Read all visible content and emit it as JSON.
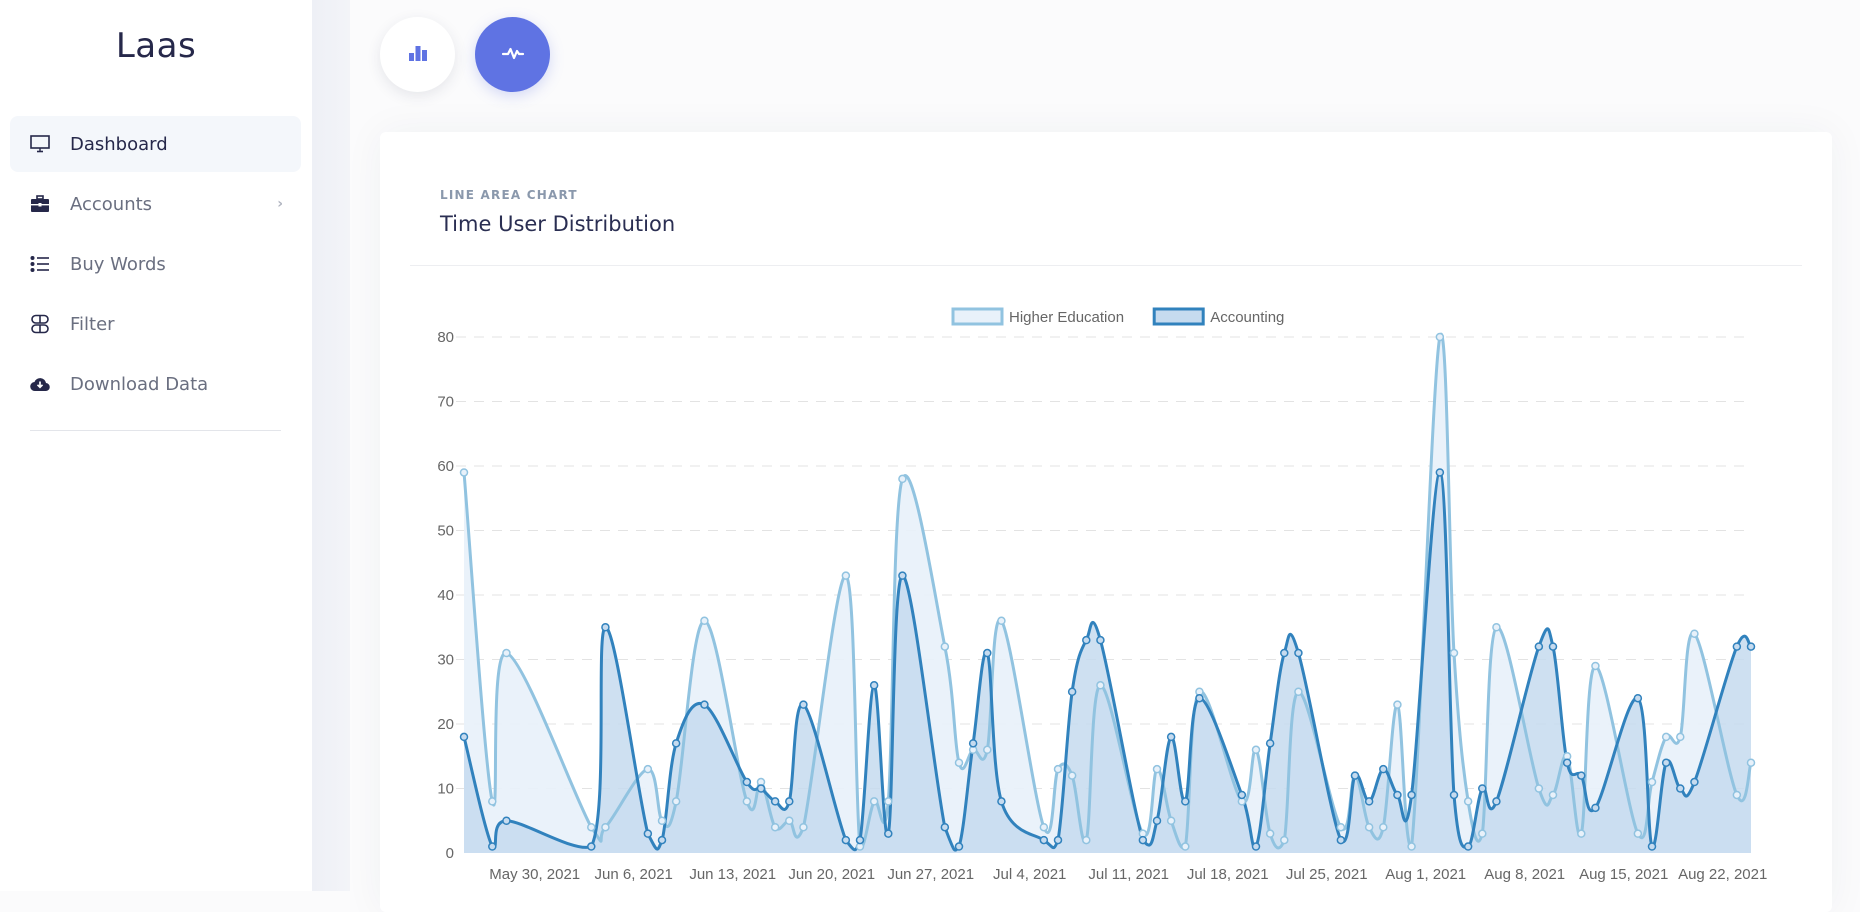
{
  "sidebar": {
    "logo": "Laas",
    "items": [
      {
        "label": "Dashboard",
        "icon": "monitor-icon",
        "active": true
      },
      {
        "label": "Accounts",
        "icon": "briefcase-icon",
        "has_submenu": true
      },
      {
        "label": "Buy Words",
        "icon": "list-icon"
      },
      {
        "label": "Filter",
        "icon": "filter-toggle-icon"
      },
      {
        "label": "Download Data",
        "icon": "cloud-download-icon"
      }
    ]
  },
  "toolbar": {
    "buttons": [
      {
        "name": "bar-chart",
        "icon": "bar-chart-icon",
        "active": false
      },
      {
        "name": "line-chart",
        "icon": "pulse-icon",
        "active": true
      }
    ],
    "accent": "#5f73e3"
  },
  "card": {
    "subtitle": "LINE AREA CHART",
    "title": "Time User Distribution"
  },
  "chart_data": {
    "type": "area",
    "title": "Time User Distribution",
    "xlabel": "",
    "ylabel": "",
    "ylim": [
      0,
      80
    ],
    "yticks": [
      0,
      10,
      20,
      30,
      40,
      50,
      60,
      70,
      80
    ],
    "xrange": [
      "2021-05-25",
      "2021-08-24"
    ],
    "xticks": [
      "May 30, 2021",
      "Jun 6, 2021",
      "Jun 13, 2021",
      "Jun 20, 2021",
      "Jun 27, 2021",
      "Jul 4, 2021",
      "Jul 11, 2021",
      "Jul 18, 2021",
      "Jul 25, 2021",
      "Aug 1, 2021",
      "Aug 8, 2021",
      "Aug 15, 2021",
      "Aug 22, 2021"
    ],
    "xtick_dates": [
      "2021-05-30",
      "2021-06-06",
      "2021-06-13",
      "2021-06-20",
      "2021-06-27",
      "2021-07-04",
      "2021-07-11",
      "2021-07-18",
      "2021-07-25",
      "2021-08-01",
      "2021-08-08",
      "2021-08-15",
      "2021-08-22"
    ],
    "grid": true,
    "legend": "top-center",
    "x": [
      "2021-05-25",
      "2021-05-27",
      "2021-05-28",
      "2021-06-03",
      "2021-06-04",
      "2021-06-07",
      "2021-06-08",
      "2021-06-09",
      "2021-06-11",
      "2021-06-14",
      "2021-06-15",
      "2021-06-16",
      "2021-06-17",
      "2021-06-18",
      "2021-06-21",
      "2021-06-22",
      "2021-06-23",
      "2021-06-24",
      "2021-06-25",
      "2021-06-28",
      "2021-06-29",
      "2021-06-30",
      "2021-07-01",
      "2021-07-02",
      "2021-07-05",
      "2021-07-06",
      "2021-07-07",
      "2021-07-08",
      "2021-07-09",
      "2021-07-12",
      "2021-07-13",
      "2021-07-14",
      "2021-07-15",
      "2021-07-16",
      "2021-07-19",
      "2021-07-20",
      "2021-07-21",
      "2021-07-22",
      "2021-07-23",
      "2021-07-26",
      "2021-07-27",
      "2021-07-28",
      "2021-07-29",
      "2021-07-30",
      "2021-07-31",
      "2021-08-02",
      "2021-08-03",
      "2021-08-04",
      "2021-08-05",
      "2021-08-06",
      "2021-08-09",
      "2021-08-10",
      "2021-08-11",
      "2021-08-12",
      "2021-08-13",
      "2021-08-16",
      "2021-08-17",
      "2021-08-18",
      "2021-08-19",
      "2021-08-20",
      "2021-08-23",
      "2021-08-24"
    ],
    "series": [
      {
        "name": "Higher Education",
        "color": "#91c3e0",
        "fill": "#e8f1fa",
        "values": [
          59,
          8,
          31,
          4,
          4,
          13,
          5,
          8,
          36,
          8,
          11,
          4,
          5,
          4,
          43,
          1,
          8,
          8,
          58,
          32,
          14,
          16,
          16,
          36,
          4,
          13,
          12,
          2,
          26,
          3,
          13,
          5,
          1,
          25,
          8,
          16,
          3,
          2,
          25,
          4,
          12,
          4,
          4,
          23,
          1,
          80,
          31,
          8,
          3,
          35,
          10,
          9,
          15,
          3,
          29,
          3,
          11,
          18,
          18,
          34,
          9,
          14
        ]
      },
      {
        "name": "Accounting",
        "color": "#3182bd",
        "fill": "#c6dbef",
        "values": [
          18,
          1,
          5,
          1,
          35,
          3,
          2,
          17,
          23,
          11,
          10,
          8,
          8,
          23,
          2,
          2,
          26,
          3,
          43,
          4,
          1,
          17,
          31,
          8,
          2,
          2,
          25,
          33,
          33,
          2,
          5,
          18,
          8,
          24,
          9,
          1,
          17,
          31,
          31,
          2,
          12,
          8,
          13,
          9,
          9,
          59,
          9,
          1,
          10,
          8,
          32,
          32,
          14,
          12,
          7,
          24,
          1,
          14,
          10,
          11,
          32,
          32
        ]
      }
    ]
  }
}
